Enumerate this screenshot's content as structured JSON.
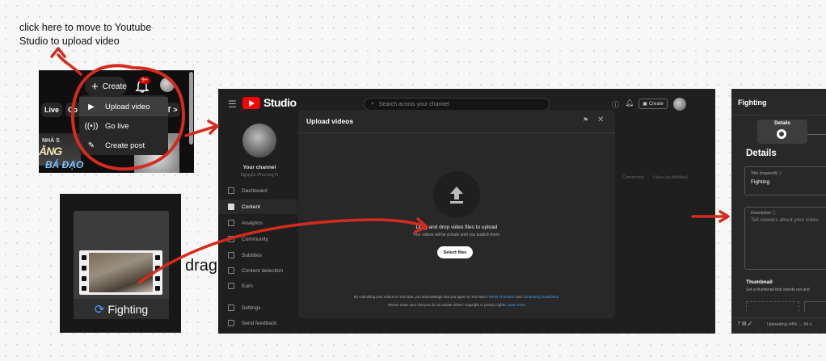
{
  "annotation": {
    "text": "click here to move to Youtube Studio to upload video",
    "drag_label": "drag"
  },
  "youtube": {
    "create_label": "Create",
    "notif_badge": "9+",
    "chips": [
      "Live",
      "Co",
      "T"
    ],
    "menu": [
      {
        "label": "Upload video",
        "icon": "upload-video-icon"
      },
      {
        "label": "Go live",
        "icon": "live-icon"
      },
      {
        "label": "Create post",
        "icon": "edit-post-icon"
      }
    ],
    "thumb_texts": [
      "NHÀ S",
      "ẰNG",
      "BÁ ĐẠO"
    ]
  },
  "file": {
    "name": "Fighting"
  },
  "studio": {
    "logo": "Studio",
    "search_placeholder": "Search across your channel",
    "create_label": "Create",
    "channel_name": "Your channel",
    "channel_sub": "Nguyễn Phương N",
    "nav": [
      "Dashboard",
      "Content",
      "Analytics",
      "Community",
      "Subtitles",
      "Content detection",
      "Earn"
    ],
    "nav_bottom": [
      "Settings",
      "Send feedback"
    ],
    "col_headers": [
      "Comments",
      "Likes (vs dislikes)"
    ],
    "dialog": {
      "title": "Upload videos",
      "main_text": "Drag and drop video files to upload",
      "sub_text": "Your videos will be private until you publish them.",
      "button": "Select files",
      "footer1_pre": "By submitting your videos to YouTube, you acknowledge that you agree to YouTube's ",
      "footer1_link1": "Terms of Service",
      "footer1_mid": " and ",
      "footer1_link2": "Community Guidelines",
      "footer1_end": ".",
      "footer2_pre": "Please make sure that you do not violate others' copyright or privacy rights. ",
      "footer2_link": "Learn more"
    }
  },
  "details": {
    "title": "Fighting",
    "step_label": "Details",
    "heading": "Details",
    "title_field_label": "Title (required) ⓘ",
    "title_field_value": "Fighting",
    "desc_field_label": "Description ⓘ",
    "desc_placeholder": "Tell viewers about your video",
    "thumbnail_heading": "Thumbnail",
    "thumbnail_sub": "Set a thumbnail that stands out and",
    "status_text": "Uploading 44% ... 34 s"
  },
  "colors": {
    "annotation_red": "#d42b1e",
    "brand_red": "#ff0000",
    "link_blue": "#3ea6ff"
  }
}
